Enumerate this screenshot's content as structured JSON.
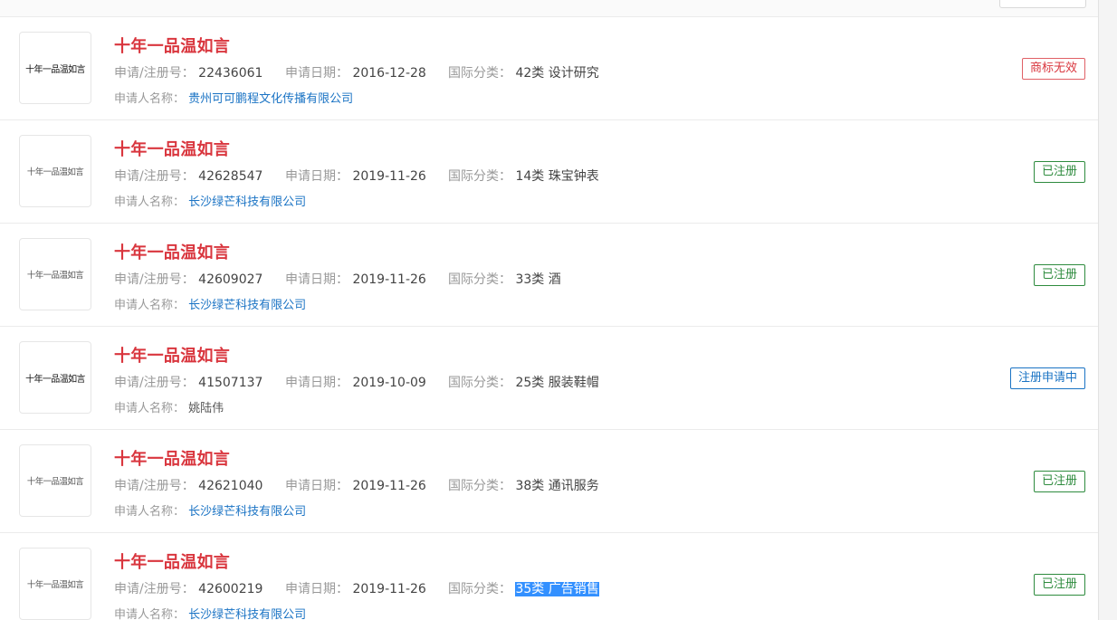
{
  "labels": {
    "reg_no": "申请/注册号：",
    "date": "申请日期：",
    "class": "国际分类：",
    "applicant": "申请人名称："
  },
  "items": [
    {
      "thumb_text": "十年一品温如言",
      "name": "十年一品温如言",
      "reg_no": "22436061",
      "date": "2016-12-28",
      "class": "42类 设计研究",
      "applicant": "贵州可可鹏程文化传播有限公司",
      "status": "商标无效",
      "status_color": "#d9363e"
    },
    {
      "thumb_text": "十年一品温如言",
      "name": "十年一品温如言",
      "reg_no": "42628547",
      "date": "2019-11-26",
      "class": "14类 珠宝钟表",
      "applicant": "长沙绿芒科技有限公司",
      "status": "已注册",
      "status_color": "#2e8b3e"
    },
    {
      "thumb_text": "十年一品温如言",
      "name": "十年一品温如言",
      "reg_no": "42609027",
      "date": "2019-11-26",
      "class": "33类 酒",
      "applicant": "长沙绿芒科技有限公司",
      "status": "已注册",
      "status_color": "#2e8b3e"
    },
    {
      "thumb_text": "十年一品温如言",
      "name": "十年一品温如言",
      "reg_no": "41507137",
      "date": "2019-10-09",
      "class": "25类 服装鞋帽",
      "applicant": "姚陆伟",
      "status": "注册申请中",
      "status_color": "#1a73c4"
    },
    {
      "thumb_text": "十年一品温如言",
      "name": "十年一品温如言",
      "reg_no": "42621040",
      "date": "2019-11-26",
      "class": "38类 通讯服务",
      "applicant": "长沙绿芒科技有限公司",
      "status": "已注册",
      "status_color": "#2e8b3e"
    },
    {
      "thumb_text": "十年一品温如言",
      "name": "十年一品温如言",
      "reg_no": "42600219",
      "date": "2019-11-26",
      "class": "35类 广告销售",
      "applicant": "长沙绿芒科技有限公司",
      "status": "已注册",
      "status_color": "#2e8b3e"
    }
  ]
}
